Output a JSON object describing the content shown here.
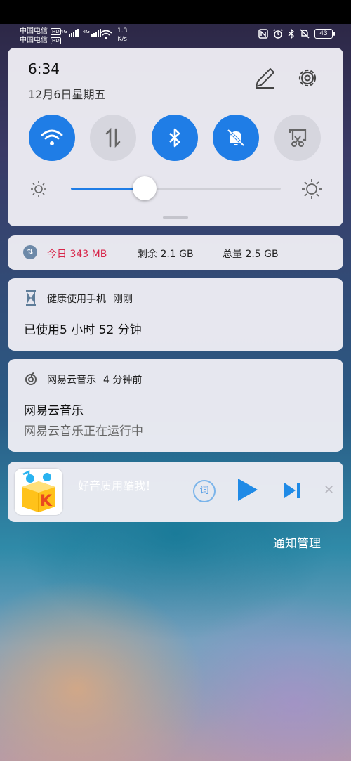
{
  "status_bar": {
    "carrier1": "中国电信",
    "carrier2": "中国电信",
    "hd_tag": "HD",
    "net_tag": "4G",
    "speed_value": "1.3",
    "speed_unit": "K/s",
    "battery_level": "43"
  },
  "quick_settings": {
    "time": "6:34",
    "date": "12月6日星期五",
    "tiles": [
      {
        "name": "wifi",
        "state": "on"
      },
      {
        "name": "mobile-data",
        "state": "off"
      },
      {
        "name": "bluetooth",
        "state": "on"
      },
      {
        "name": "mute",
        "state": "on"
      },
      {
        "name": "screenshot",
        "state": "off"
      }
    ],
    "brightness_fraction": 0.35
  },
  "data_usage": {
    "today": "今日 343 MB",
    "remaining": "剩余 2.1 GB",
    "total": "总量 2.5 GB"
  },
  "health_notification": {
    "app": "健康使用手机",
    "time": "刚刚",
    "body": "已使用5 小时 52 分钟"
  },
  "music163_notification": {
    "app": "网易云音乐",
    "time": "4 分钟前",
    "title": "网易云音乐",
    "text": "网易云音乐正在运行中"
  },
  "music_player": {
    "slogan": "好音质用酷我！",
    "lyrics_label": "词",
    "cover_letter": "K"
  },
  "footer": {
    "manage_label": "通知管理"
  },
  "colors": {
    "accent": "#1f7de6",
    "today_red": "#d8264a"
  }
}
